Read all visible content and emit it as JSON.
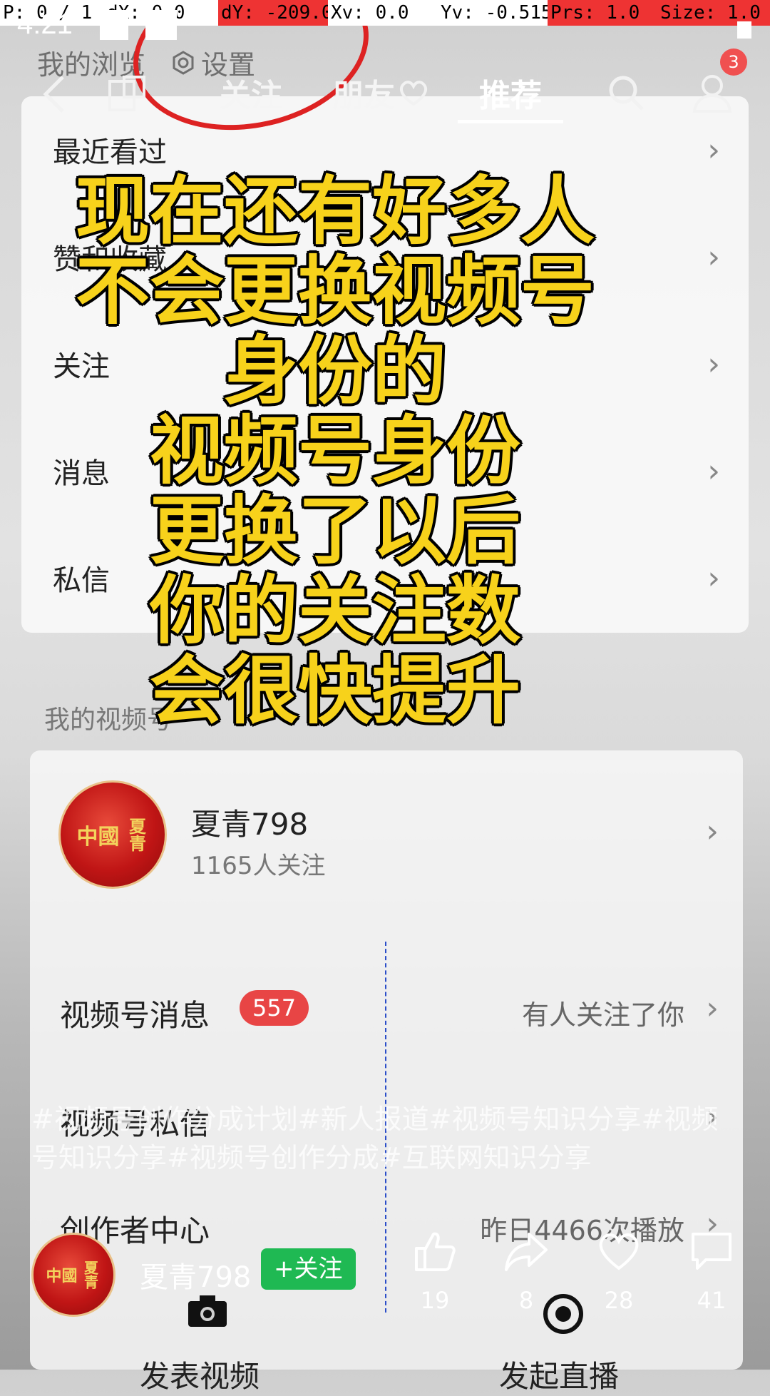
{
  "debug_bar": {
    "p": "P: 0 / 1",
    "dx": "dX: 0.0",
    "dy": "dY: -209.0",
    "xv": "Xv: 0.0",
    "yv": "Yv: -0.515",
    "prs": "Prs: 1.0",
    "size": "Size: 1.0"
  },
  "status": {
    "time": "4:21"
  },
  "profile_header": {
    "my_browse": "我的浏览",
    "settings": "设置"
  },
  "top_nav": {
    "back_icon": "chevron-left-icon",
    "tabs": [
      "关注",
      "朋友",
      "推荐"
    ],
    "active_tab": "推荐",
    "notification_count": "3"
  },
  "menu": {
    "items": [
      "最近看过",
      "赞和收藏",
      "关注",
      "消息",
      "私信"
    ]
  },
  "overlay_caption": {
    "lines": [
      "现在还有好多人",
      "不会更换视频号",
      "身份的",
      "视频号身份",
      "更换了以后",
      "你的关注数",
      "会很快提升"
    ]
  },
  "my_video": {
    "section_title": "我的视频号",
    "account_name": "夏青798",
    "followers": "1165人关注",
    "rows": [
      {
        "label": "视频号消息",
        "badge": "557",
        "right": "有人关注了你"
      },
      {
        "label": "视频号私信",
        "badge": "",
        "right": ""
      },
      {
        "label": "创作者中心",
        "badge": "",
        "right": "昨日4466次播放"
      }
    ],
    "bottom_actions": [
      "发表视频",
      "发起直播"
    ]
  },
  "video_info": {
    "hashtags": "#视频号创作分成计划#新人报道#视频号知识分享#视频号知识分享#视频号创作分成#互联网知识分享",
    "author": "夏青798",
    "follow_label": "+关注",
    "likes": "19",
    "shares": "8",
    "favorites": "28",
    "comments": "41"
  },
  "avatar_text": {
    "main": "中國",
    "side": "夏青"
  },
  "colors": {
    "accent_green": "#1fb953",
    "badge_red": "#e84545",
    "caption_yellow": "#f7d21b"
  }
}
